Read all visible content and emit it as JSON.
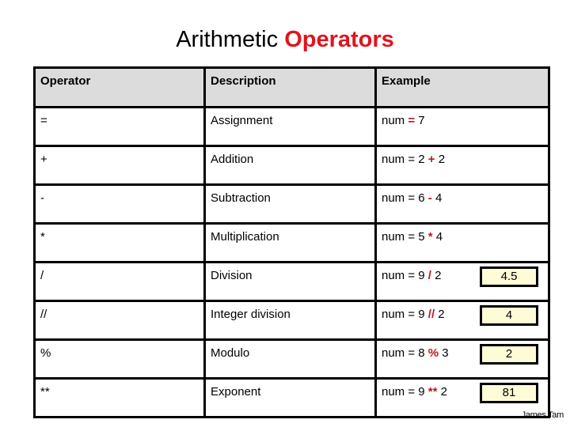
{
  "title": {
    "prefix": "Arithmetic",
    "accent": "Operators",
    "accent_color": "#e0141e"
  },
  "table": {
    "headers": [
      "Operator",
      "Description",
      "Example"
    ],
    "rows": [
      {
        "operator": "=",
        "description": "Assignment",
        "example_pre": "num ",
        "example_op": "=",
        "example_post": " 7",
        "result": null
      },
      {
        "operator": "+",
        "description": "Addition",
        "example_pre": "num = 2 ",
        "example_op": "+",
        "example_post": " 2",
        "result": null
      },
      {
        "operator": "-",
        "description": "Subtraction",
        "example_pre": "num = 6 ",
        "example_op": "-",
        "example_post": " 4",
        "result": null
      },
      {
        "operator": "*",
        "description": "Multiplication",
        "example_pre": "num = 5 ",
        "example_op": "*",
        "example_post": " 4",
        "result": null
      },
      {
        "operator": "/",
        "description": "Division",
        "example_pre": "num = 9 ",
        "example_op": "/",
        "example_post": " 2",
        "result": "4.5"
      },
      {
        "operator": "//",
        "description": "Integer division",
        "example_pre": "num = 9 ",
        "example_op": "//",
        "example_post": " 2",
        "result": "4"
      },
      {
        "operator": "%",
        "description": "Modulo",
        "example_pre": "num = 8 ",
        "example_op": "%",
        "example_post": " 3",
        "result": "2"
      },
      {
        "operator": "**",
        "description": "Exponent",
        "example_pre": "num = 9 ",
        "example_op": "**",
        "example_post": " 2",
        "result": "81"
      }
    ],
    "header_bg": "#dcdcdc",
    "result_bg": "#fefcd6",
    "operator_highlight_color": "#c0141c"
  },
  "credit": "James Tam"
}
